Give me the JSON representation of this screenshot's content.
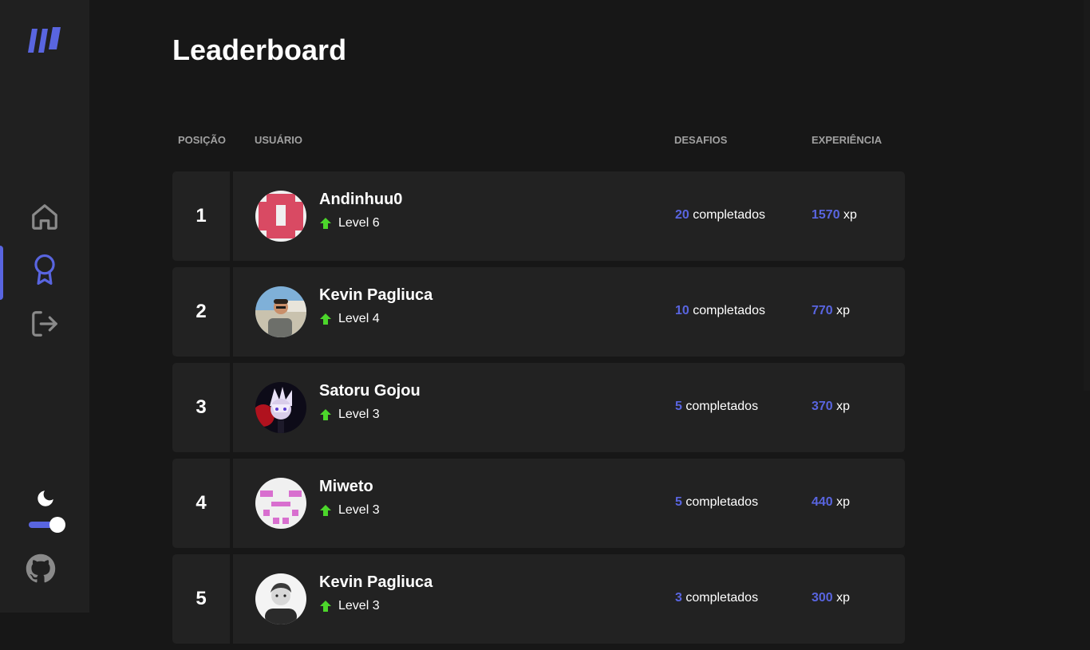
{
  "page": {
    "title": "Leaderboard"
  },
  "colors": {
    "accent": "#5965e0",
    "level_up": "#4cd62b",
    "background": "#171717",
    "card": "#222222"
  },
  "sidebar": {
    "logo_icon": "logo-icon",
    "items": [
      {
        "name": "home",
        "icon": "home-icon",
        "active": false
      },
      {
        "name": "leaderboard",
        "icon": "award-icon",
        "active": true
      },
      {
        "name": "logout",
        "icon": "logout-icon",
        "active": false
      }
    ],
    "theme_icon": "moon-icon",
    "theme_toggle_on": true,
    "github_icon": "github-icon"
  },
  "table": {
    "headers": {
      "position": "POSIÇÃO",
      "user": "USUÁRIO",
      "challenges": "DESAFIOS",
      "experience": "EXPERIÊNCIA"
    },
    "challenges_suffix": "completados",
    "xp_suffix": "xp",
    "rows": [
      {
        "position": "1",
        "name": "Andinhuu0",
        "level": "Level 6",
        "challenges": "20",
        "xp": "1570"
      },
      {
        "position": "2",
        "name": "Kevin Pagliuca",
        "level": "Level 4",
        "challenges": "10",
        "xp": "770"
      },
      {
        "position": "3",
        "name": "Satoru Gojou",
        "level": "Level 3",
        "challenges": "5",
        "xp": "370"
      },
      {
        "position": "4",
        "name": "Miweto",
        "level": "Level 3",
        "challenges": "5",
        "xp": "440"
      },
      {
        "position": "5",
        "name": "Kevin Pagliuca",
        "level": "Level 3",
        "challenges": "3",
        "xp": "300"
      }
    ]
  }
}
